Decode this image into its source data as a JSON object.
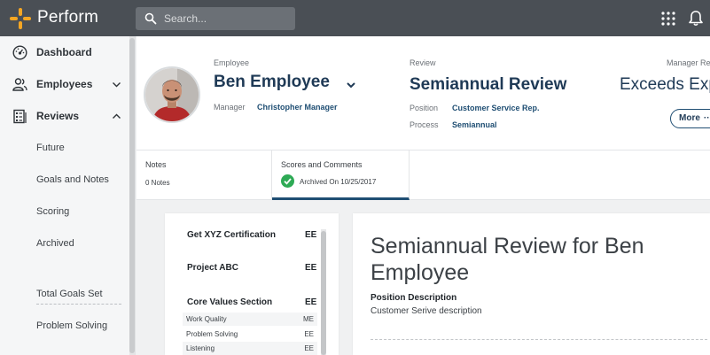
{
  "app": {
    "name": "Perform",
    "accent": "#f5a623"
  },
  "search": {
    "placeholder": "Search..."
  },
  "sidebar": {
    "items": [
      {
        "label": "Dashboard",
        "icon": "dashboard-icon"
      },
      {
        "label": "Employees",
        "icon": "people-icon",
        "chevron": "down"
      },
      {
        "label": "Reviews",
        "icon": "reviews-icon",
        "chevron": "up"
      }
    ],
    "review_subitems": [
      "Future",
      "Goals and Notes",
      "Scoring",
      "Archived"
    ],
    "summary_items": [
      "Total Goals Set",
      "Problem Solving"
    ]
  },
  "header": {
    "employee_label": "Employee",
    "employee_name": "Ben Employee",
    "manager_label": "Manager",
    "manager_name": "Christopher Manager",
    "review_label": "Review",
    "review_title": "Semiannual Review",
    "position_label": "Position",
    "position_value": "Customer Service Rep.",
    "process_label": "Process",
    "process_value": "Semiannual",
    "manager_rating_label": "Manager Rev",
    "manager_rating": "Exceeds Exp",
    "more_label": "More",
    "more_dots": "···"
  },
  "tabs": {
    "notes": {
      "title": "Notes",
      "sub": "0 Notes"
    },
    "scores": {
      "title": "Scores and Comments",
      "sub": "Archived On 10/25/2017"
    }
  },
  "scores": {
    "sections": [
      {
        "name": "Get XYZ Certification",
        "score": "EE"
      },
      {
        "name": "Project ABC",
        "score": "EE"
      },
      {
        "name": "Core Values Section",
        "score": "EE"
      }
    ],
    "core_values": [
      {
        "name": "Work Quality",
        "score": "ME"
      },
      {
        "name": "Problem Solving",
        "score": "EE"
      },
      {
        "name": "Listening",
        "score": "EE"
      }
    ]
  },
  "detail": {
    "title": "Semiannual Review for Ben Employee",
    "position_desc_label": "Position Description",
    "position_desc": "Customer Serive description"
  }
}
